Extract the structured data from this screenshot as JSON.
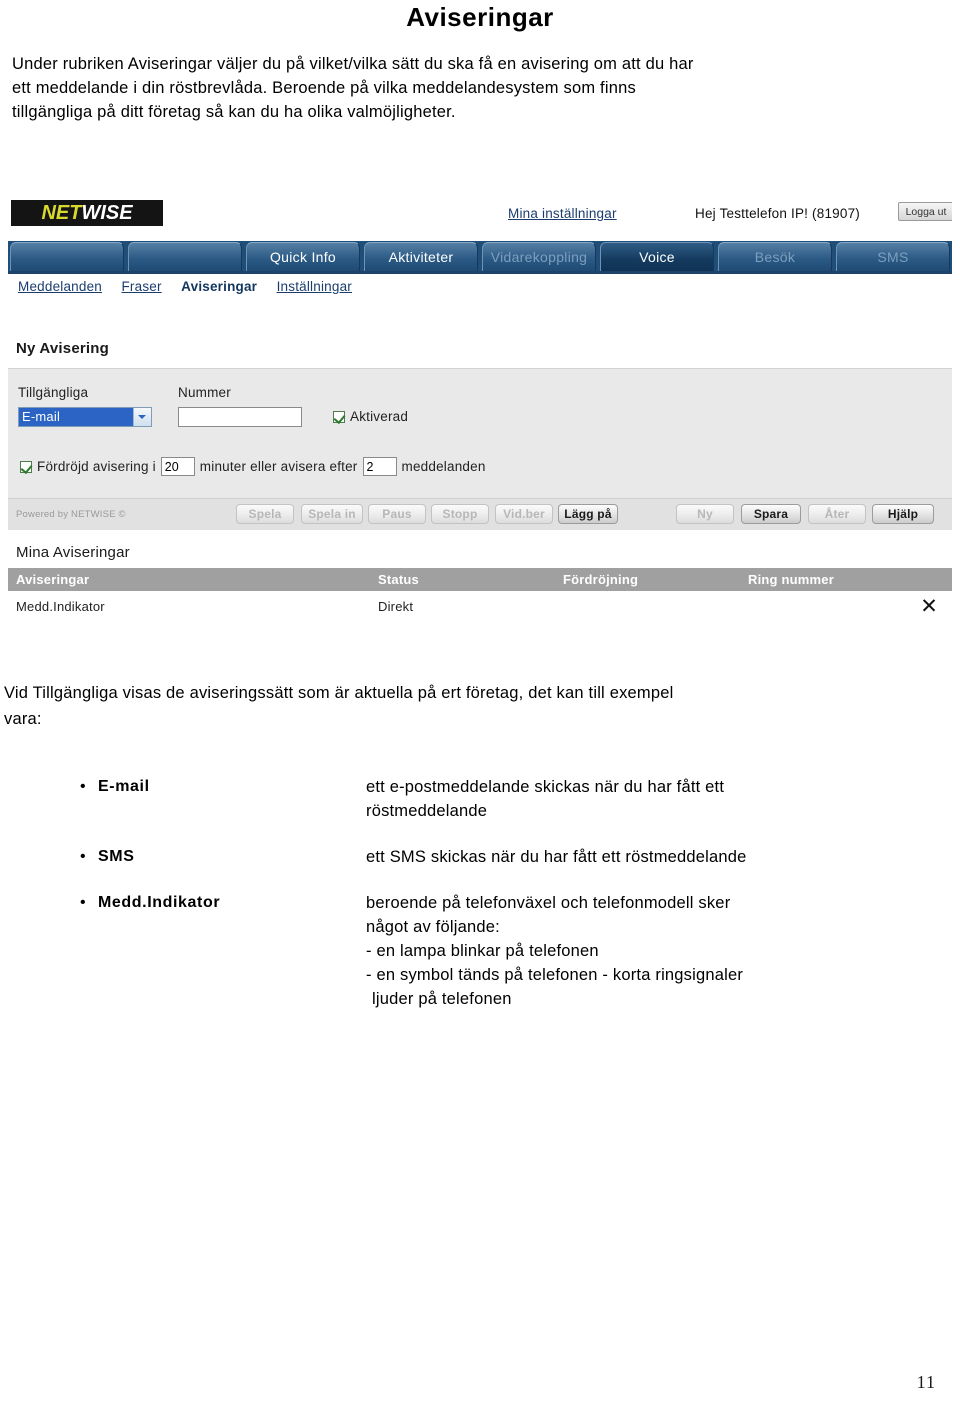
{
  "document": {
    "title": "Aviseringar",
    "intro_lines": [
      "Under rubriken Aviseringar väljer du på vilket/vilka sätt du ska få en avisering om att du har",
      "ett meddelande i din röstbrevlåda. Beroende på vilka meddelandesystem som finns",
      "tillgängliga på ditt företag så kan du ha olika valmöjligheter."
    ],
    "paragraph2_lines": [
      "Vid Tillgängliga visas de aviseringssätt som är aktuella på ert företag, det kan till exempel",
      "vara:"
    ],
    "page_number": "11"
  },
  "app": {
    "logo": {
      "part1": "NET",
      "part2": "WISE"
    },
    "header": {
      "settings_link": "Mina inställningar",
      "greeting": "Hej Testtelefon IP! (81907)",
      "logout_label": "Logga ut"
    },
    "tabs": [
      {
        "label": "",
        "state": "empty"
      },
      {
        "label": "",
        "state": "empty"
      },
      {
        "label": "Quick Info",
        "state": "normal"
      },
      {
        "label": "Aktiviteter",
        "state": "normal"
      },
      {
        "label": "Vidarekoppling",
        "state": "dim"
      },
      {
        "label": "Voice",
        "state": "active"
      },
      {
        "label": "Besök",
        "state": "dim"
      },
      {
        "label": "SMS",
        "state": "dim"
      }
    ],
    "subnav": [
      {
        "label": "Meddelanden",
        "current": false
      },
      {
        "label": "Fraser",
        "current": false
      },
      {
        "label": "Aviseringar",
        "current": true
      },
      {
        "label": "Inställningar",
        "current": false
      }
    ],
    "form": {
      "heading": "Ny Avisering",
      "label_tillgangliga": "Tillgängliga",
      "label_nummer": "Nummer",
      "select_value": "E-mail",
      "nummer_value": "",
      "aktiverad_label": "Aktiverad",
      "delay_prefix": "Fördröjd avisering i",
      "delay_minutes": "20",
      "delay_middle": "minuter eller avisera efter",
      "delay_count": "2",
      "delay_suffix": "meddelanden"
    },
    "buttons": {
      "powered_by": "Powered by NETWISE ©",
      "left_group": [
        {
          "label": "Spela",
          "enabled": false
        },
        {
          "label": "Spela in",
          "enabled": false
        },
        {
          "label": "Paus",
          "enabled": false
        },
        {
          "label": "Stopp",
          "enabled": false
        },
        {
          "label": "Vid.ber",
          "enabled": false
        },
        {
          "label": "Lägg på",
          "enabled": true
        }
      ],
      "right_group": [
        {
          "label": "Ny",
          "enabled": false
        },
        {
          "label": "Spara",
          "enabled": true
        },
        {
          "label": "Åter",
          "enabled": false
        },
        {
          "label": "Hjälp",
          "enabled": true
        }
      ]
    },
    "table": {
      "heading": "Mina Aviseringar",
      "columns": [
        "Aviseringar",
        "Status",
        "Fördröjning",
        "Ring nummer"
      ],
      "rows": [
        {
          "aviseringar": "Medd.Indikator",
          "status": "Direkt",
          "fordrojning": "",
          "ring_nummer": "",
          "delete_icon": "✕"
        }
      ]
    }
  },
  "bullets": [
    {
      "marker": "•",
      "term": "E-mail",
      "desc_lines": [
        "ett e-postmeddelande skickas när du har fått ett",
        "röstmeddelande"
      ]
    },
    {
      "marker": "•",
      "term": "SMS",
      "desc_lines": [
        "ett SMS skickas när du har fått ett röstmeddelande"
      ]
    },
    {
      "marker": "•",
      "term": "Medd.Indikator",
      "desc_lines": [
        "beroende på telefonväxel och telefonmodell sker",
        "något av följande:",
        "- en lampa blinkar på telefonen",
        "- en symbol tänds på telefonen - korta ringsignaler",
        " ljuder på telefonen"
      ]
    }
  ],
  "colors": {
    "tab_blue": "#2c5b86",
    "tab_active_blue": "#143a5e",
    "table_header_gray": "#a0a0a0",
    "panel_gray": "#e9e9e9",
    "logo_yellow": "#d8d92c",
    "select_highlight": "#2b64c4"
  }
}
